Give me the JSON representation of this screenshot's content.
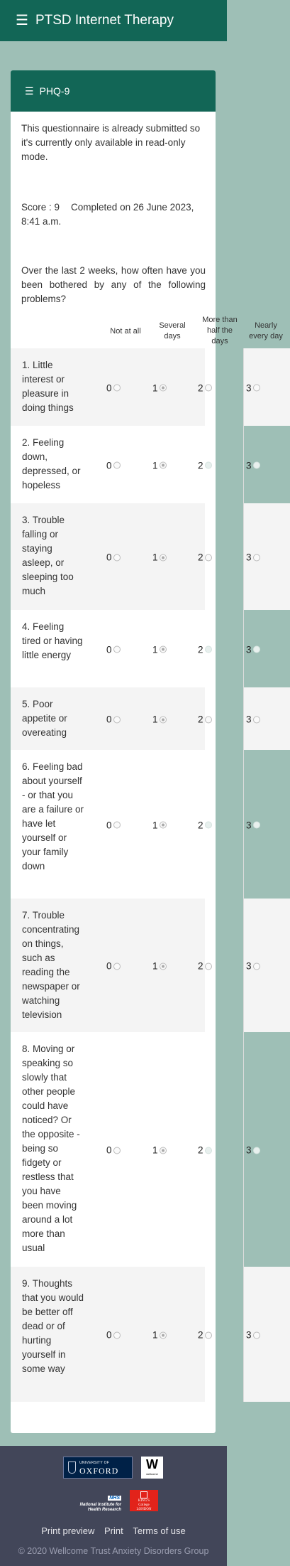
{
  "app": {
    "title": "PTSD Internet Therapy",
    "menu_icon": "hamburger-icon"
  },
  "card": {
    "title": "PHQ-9",
    "readonly_note": "This questionnaire is already submitted so it's currently only available in read-only mode.",
    "score_label": "Score : 9",
    "completed_label": "Completed on 26 June 2023, 8:41 a.m.",
    "prompt": "Over the last 2 weeks, how often have you been bothered by any of the following problems?"
  },
  "columns": [
    {
      "label": "Not at all",
      "value": "0"
    },
    {
      "label": "Several days",
      "value": "1"
    },
    {
      "label": "More than half the days",
      "value": "2"
    },
    {
      "label": "Nearly every day",
      "value": "3"
    }
  ],
  "questions": [
    {
      "label": "1. Little interest or pleasure in doing things",
      "selected": 1
    },
    {
      "label": "2. Feeling down, depressed, or hopeless",
      "selected": 1
    },
    {
      "label": "3. Trouble falling or staying asleep, or sleeping too much",
      "selected": 1
    },
    {
      "label": "4. Feeling tired or having little energy",
      "selected": 1
    },
    {
      "label": "5. Poor appetite or overeating",
      "selected": 1
    },
    {
      "label": "6. Feeling bad about yourself - or that you are a failure or have let yourself or your family down",
      "selected": 1
    },
    {
      "label": "7. Trouble concentrating on things, such as reading the newspaper or watching television",
      "selected": 1
    },
    {
      "label": "8. Moving or speaking so slowly that other people could have noticed? Or the opposite - being so fidgety or restless that you have been moving around a lot more than usual",
      "selected": 1
    },
    {
      "label": "9. Thoughts that you would be better off dead or of hurting yourself in some way",
      "selected": 1
    }
  ],
  "footer": {
    "oxford": {
      "university": "UNIVERSITY OF",
      "name": "OXFORD"
    },
    "wellcome": {
      "mark": "W",
      "name": "wellcome"
    },
    "nihr": {
      "nhs": "NHS",
      "line1": "National Institute for",
      "line2": "Health Research"
    },
    "kings": {
      "line1": "KING'S",
      "line2": "College",
      "line3": "LONDON"
    },
    "links": [
      "Print preview",
      "Print",
      "Terms of use"
    ],
    "copyright": "© 2020 Wellcome Trust Anxiety Disorders Group"
  },
  "colors": {
    "primary": "#126656",
    "page_background": "#9ebfb6",
    "footer": "#424659"
  }
}
